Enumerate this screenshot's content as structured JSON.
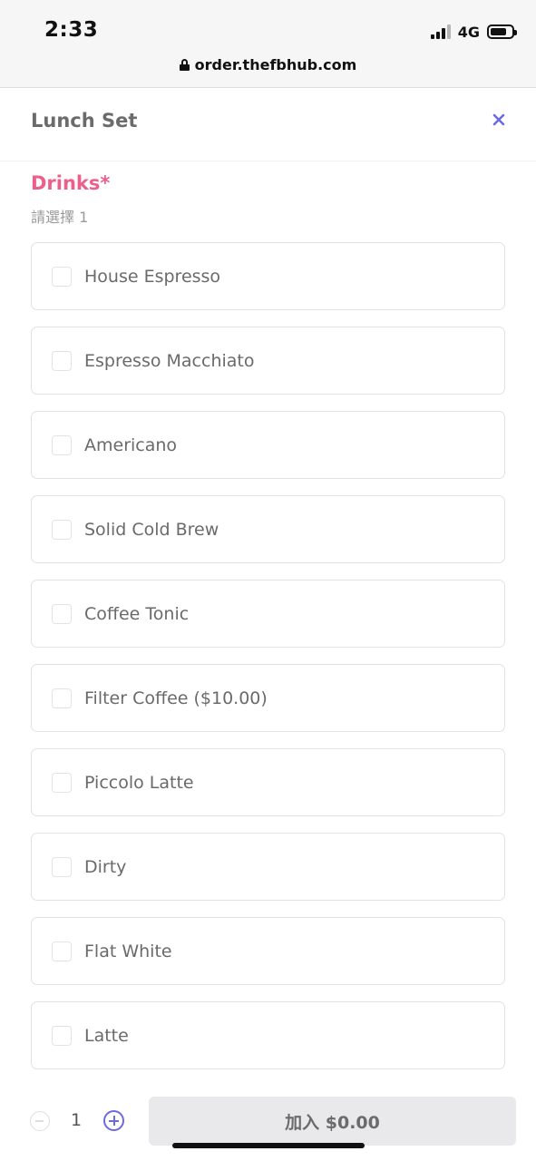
{
  "status_bar": {
    "time": "2:33",
    "network": "4G",
    "battery_level": 0.7
  },
  "browser": {
    "url": "order.thefbhub.com"
  },
  "modal": {
    "title": "Lunch Set",
    "close_icon": "close-icon",
    "accent_color": "#6b6be0"
  },
  "section": {
    "title": "Drinks*",
    "title_color": "#ec5f8a",
    "subtitle": "請選擇 1",
    "options": [
      {
        "label": "House Espresso",
        "checked": false
      },
      {
        "label": "Espresso Macchiato",
        "checked": false
      },
      {
        "label": "Americano",
        "checked": false
      },
      {
        "label": "Solid Cold Brew",
        "checked": false
      },
      {
        "label": "Coffee Tonic",
        "checked": false
      },
      {
        "label": "Filter Coffee ($10.00)",
        "checked": false
      },
      {
        "label": "Piccolo Latte",
        "checked": false
      },
      {
        "label": "Dirty",
        "checked": false
      },
      {
        "label": "Flat White",
        "checked": false
      },
      {
        "label": "Latte",
        "checked": false
      }
    ]
  },
  "footer": {
    "quantity": "1",
    "add_button_label": "加入 $0.00"
  }
}
